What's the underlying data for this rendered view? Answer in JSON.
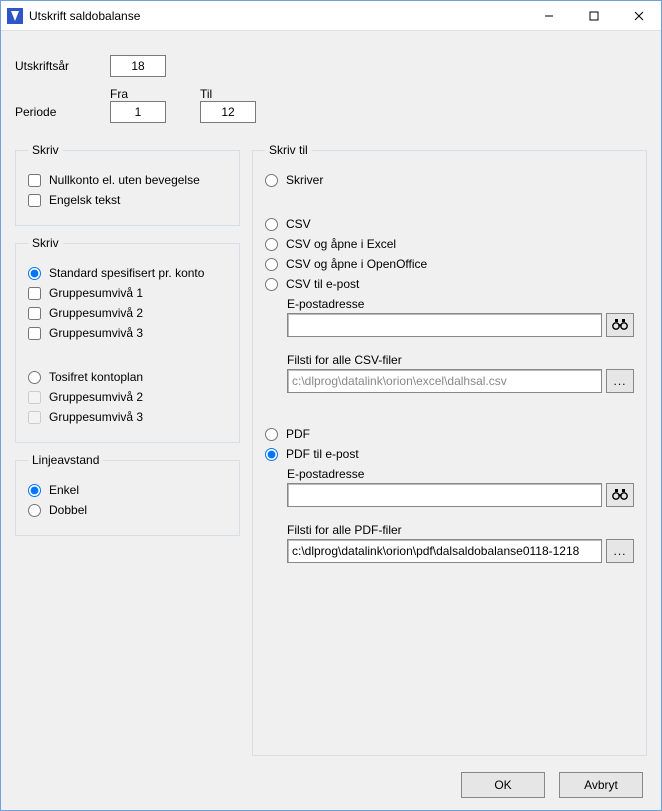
{
  "window": {
    "title": "Utskrift saldobalanse"
  },
  "top": {
    "year_label": "Utskriftsår",
    "year_value": "18",
    "period_label": "Periode",
    "from_label": "Fra",
    "to_label": "Til",
    "from_value": "1",
    "to_value": "12"
  },
  "skriv_opts": {
    "legend": "Skriv",
    "null_label": "Nullkonto el. uten bevegelse",
    "eng_label": "Engelsk tekst"
  },
  "skriv_spec": {
    "legend": "Skriv",
    "std_label": "Standard spesifisert pr. konto",
    "g1": "Gruppesumvivå 1",
    "g2": "Gruppesumvivå 2",
    "g3": "Gruppesumvivå 3",
    "tosifret": "Tosifret kontoplan",
    "g2b": "Gruppesumvivå 2",
    "g3b": "Gruppesumvivå 3"
  },
  "linje": {
    "legend": "Linjeavstand",
    "enkel": "Enkel",
    "dobbel": "Dobbel"
  },
  "skrivtil": {
    "legend": "Skriv til",
    "skriver": "Skriver",
    "csv": "CSV",
    "csv_excel": "CSV og åpne i Excel",
    "csv_oo": "CSV og åpne i OpenOffice",
    "csv_mail": "CSV til e-post",
    "epost_label": "E-postadresse",
    "csv_path_label": "Filsti for alle CSV-filer",
    "csv_path_value": "c:\\dlprog\\datalink\\orion\\excel\\dalhsal.csv",
    "pdf": "PDF",
    "pdf_mail": "PDF til e-post",
    "pdf_path_label": "Filsti for alle PDF-filer",
    "pdf_path_value": "c:\\dlprog\\datalink\\orion\\pdf\\dalsaldobalanse0118-1218",
    "browse": "..."
  },
  "footer": {
    "ok": "OK",
    "cancel": "Avbryt"
  }
}
